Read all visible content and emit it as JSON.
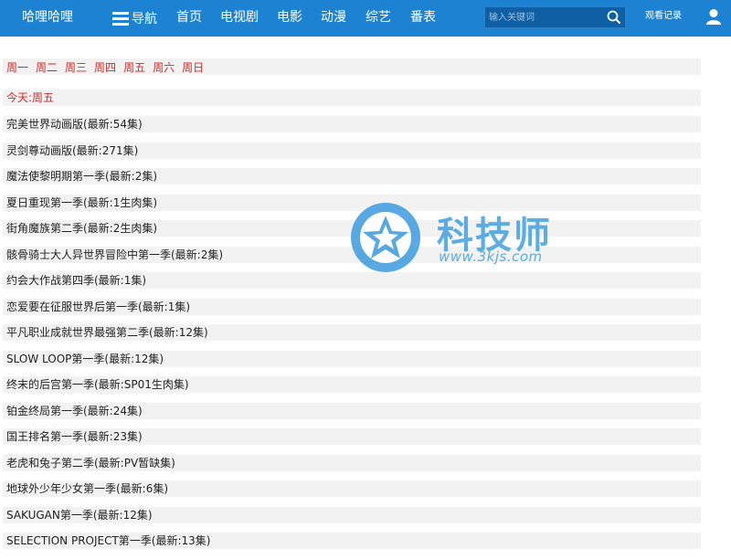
{
  "header": {
    "logo": "哈哩哈哩",
    "nav_label": "导航",
    "links": [
      "首页",
      "电视剧",
      "电影",
      "动漫",
      "综艺",
      "番表"
    ],
    "search_placeholder": "输入关键词",
    "history": "观看记录"
  },
  "weekdays": [
    "周一",
    "周二",
    "周三",
    "周四",
    "周五",
    "周六",
    "周日"
  ],
  "today_label": "今天:周五",
  "shows": [
    "完美世界动画版(最新:54集)",
    "灵剑尊动画版(最新:271集)",
    "魔法使黎明期第一季(最新:2集)",
    "夏日重现第一季(最新:1生肉集)",
    "街角魔族第二季(最新:2生肉集)",
    "骸骨骑士大人异世界冒险中第一季(最新:2集)",
    "约会大作战第四季(最新:1集)",
    "恋爱要在征服世界后第一季(最新:1集)",
    "平凡职业成就世界最强第二季(最新:12集)",
    "SLOW LOOP第一季(最新:12集)",
    "终末的后宫第一季(最新:SP01生肉集)",
    "铂金终局第一季(最新:24集)",
    "国王排名第一季(最新:23集)",
    "老虎和兔子第二季(最新:PV暂缺集)",
    "地球外少年少女第一季(最新:6集)",
    "SAKUGAN第一季(最新:12集)",
    "SELECTION PROJECT第一季(最新:13集)"
  ],
  "watermark": {
    "title": "科技师",
    "url": "www.3kjs.com"
  },
  "colors": {
    "header_bg": "#1e82d2",
    "accent_red": "#d6282a",
    "row_bg": "#f2f2f2",
    "watermark": "#40a0e0"
  }
}
